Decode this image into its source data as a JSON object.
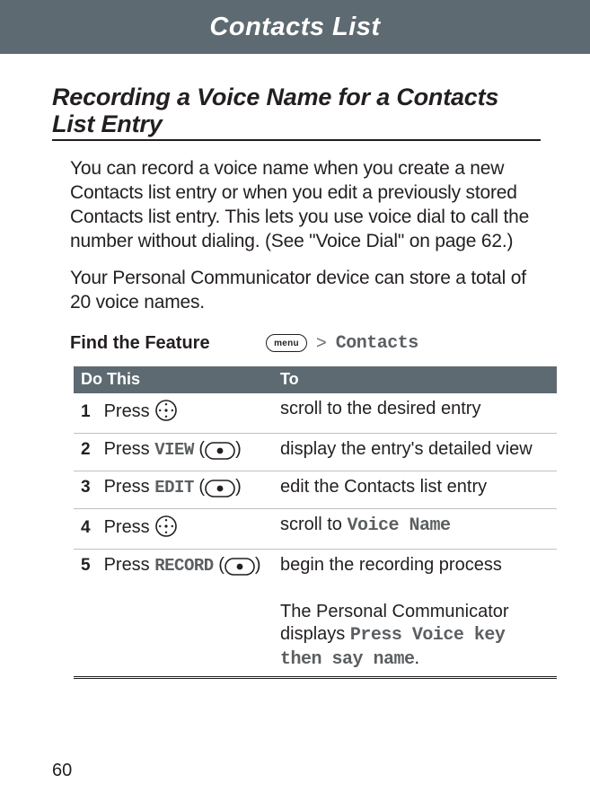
{
  "banner": "Contacts List",
  "heading": "Recording a Voice Name for a Contacts List Entry",
  "para1": "You can record a voice name when you create a new Contacts list entry or when you edit a previously stored Contacts list entry. This lets you use voice dial to call the number without dialing. (See \"Voice Dial\" on page 62.)",
  "para2": "Your Personal Communicator device can store a total of 20 voice names.",
  "feature": {
    "label": "Find the Feature",
    "menu": "menu",
    "gt": ">",
    "target": "Contacts"
  },
  "table": {
    "headers": {
      "do": "Do This",
      "to": "To"
    },
    "rows": [
      {
        "num": "1",
        "action_prefix": "Press ",
        "soft": "",
        "icon": "nav",
        "result": "scroll to the desired entry"
      },
      {
        "num": "2",
        "action_prefix": "Press ",
        "soft": "VIEW",
        "icon": "select",
        "result": "display the entry's detailed view"
      },
      {
        "num": "3",
        "action_prefix": "Press ",
        "soft": "EDIT",
        "icon": "select",
        "result": "edit the Contacts list entry"
      },
      {
        "num": "4",
        "action_prefix": "Press ",
        "soft": "",
        "icon": "nav",
        "result_prefix": "scroll to ",
        "result_mono": "Voice Name"
      },
      {
        "num": "5",
        "action_prefix": "Press ",
        "soft": "RECORD",
        "icon": "select",
        "result": "begin the recording process"
      }
    ],
    "footer": {
      "line1": "The Personal Communicator displays ",
      "mono": "Press Voice key then say name",
      "period": "."
    }
  },
  "pageNum": "60"
}
